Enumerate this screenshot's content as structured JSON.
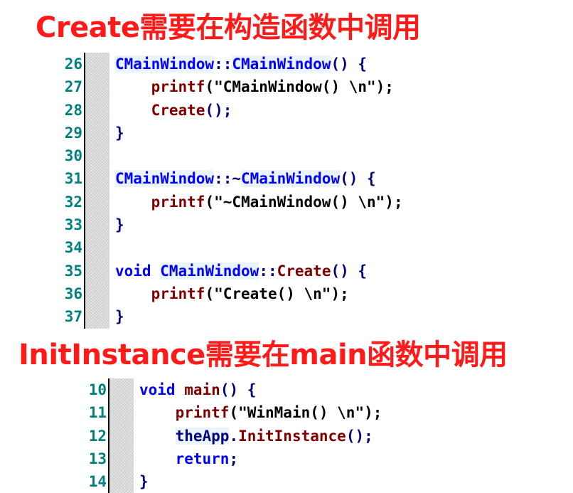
{
  "heading_top": "Create需要在构造函数中调用",
  "heading_bottom": "InitInstance需要在main函数中调用",
  "panel_top": {
    "lines": [
      {
        "n": "26",
        "tokens": [
          {
            "t": "CMainWindow",
            "k": "class"
          },
          {
            "t": "::",
            "k": "plain"
          },
          {
            "t": "CMainWindow",
            "k": "class"
          },
          {
            "t": "() {",
            "k": "plain"
          }
        ]
      },
      {
        "n": "27",
        "tokens": [
          {
            "t": "    ",
            "k": "plain"
          },
          {
            "t": "printf",
            "k": "func"
          },
          {
            "t": "(\"CMainWindow() \\n\");",
            "k": "str"
          }
        ]
      },
      {
        "n": "28",
        "tokens": [
          {
            "t": "    ",
            "k": "plain"
          },
          {
            "t": "Create",
            "k": "func"
          },
          {
            "t": "();",
            "k": "plain"
          }
        ]
      },
      {
        "n": "29",
        "tokens": [
          {
            "t": "}",
            "k": "plain"
          }
        ]
      },
      {
        "n": "30",
        "tokens": []
      },
      {
        "n": "31",
        "tokens": [
          {
            "t": "CMainWindow",
            "k": "class"
          },
          {
            "t": "::~",
            "k": "plain"
          },
          {
            "t": "CMainWindow",
            "k": "class"
          },
          {
            "t": "() {",
            "k": "plain"
          }
        ]
      },
      {
        "n": "32",
        "tokens": [
          {
            "t": "    ",
            "k": "plain"
          },
          {
            "t": "printf",
            "k": "func"
          },
          {
            "t": "(\"~CMainWindow() \\n\");",
            "k": "str"
          }
        ]
      },
      {
        "n": "33",
        "tokens": [
          {
            "t": "}",
            "k": "plain"
          }
        ]
      },
      {
        "n": "34",
        "tokens": []
      },
      {
        "n": "35",
        "tokens": [
          {
            "t": "void",
            "k": "kw"
          },
          {
            "t": " ",
            "k": "plain"
          },
          {
            "t": "CMainWindow",
            "k": "class"
          },
          {
            "t": "::",
            "k": "plain"
          },
          {
            "t": "Create",
            "k": "func"
          },
          {
            "t": "() {",
            "k": "plain"
          }
        ]
      },
      {
        "n": "36",
        "tokens": [
          {
            "t": "    ",
            "k": "plain"
          },
          {
            "t": "printf",
            "k": "func"
          },
          {
            "t": "(\"Create() \\n\");",
            "k": "str"
          }
        ]
      },
      {
        "n": "37",
        "tokens": [
          {
            "t": "}",
            "k": "plain"
          }
        ]
      }
    ]
  },
  "panel_bottom": {
    "lines": [
      {
        "n": "10",
        "tokens": [
          {
            "t": "void",
            "k": "kw"
          },
          {
            "t": " ",
            "k": "plain"
          },
          {
            "t": "main",
            "k": "func"
          },
          {
            "t": "() {",
            "k": "plain"
          }
        ]
      },
      {
        "n": "11",
        "tokens": [
          {
            "t": "    ",
            "k": "plain"
          },
          {
            "t": "printf",
            "k": "func"
          },
          {
            "t": "(\"WinMain() \\n\");",
            "k": "str"
          }
        ]
      },
      {
        "n": "12",
        "tokens": [
          {
            "t": "    ",
            "k": "plain"
          },
          {
            "t": "theApp",
            "k": "var"
          },
          {
            "t": ".",
            "k": "plain"
          },
          {
            "t": "InitInstance",
            "k": "func"
          },
          {
            "t": "();",
            "k": "plain"
          }
        ]
      },
      {
        "n": "13",
        "tokens": [
          {
            "t": "    ",
            "k": "plain"
          },
          {
            "t": "return",
            "k": "kw"
          },
          {
            "t": ";",
            "k": "plain"
          }
        ]
      },
      {
        "n": "14",
        "tokens": [
          {
            "t": "}",
            "k": "plain"
          }
        ]
      }
    ]
  }
}
